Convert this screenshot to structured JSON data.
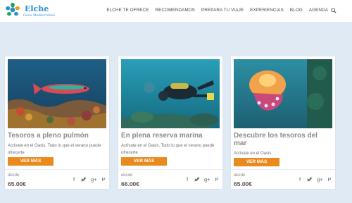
{
  "header": {
    "logo_text": "Elche",
    "logo_subtitle": "Oasis Mediterráneo",
    "nav": [
      "ELCHE TE OFRECE",
      "RECOMENDAMOS",
      "PREPARA TU VIAJE",
      "EXPERIENCIAS",
      "BLOG",
      "AGENDA"
    ]
  },
  "cards": [
    {
      "title": "Tesoros a pleno pulmón",
      "desc": "Actívate en el Oasis, Todo lo que el verano puede ofrecerte",
      "button": "VER MÁS",
      "desde": "desde",
      "price": "65.00€"
    },
    {
      "title": "En plena reserva marina",
      "desc": "Actívate en el Oasis, Todo lo que el verano puede ofrecerte",
      "button": "VER MÁS",
      "desde": "desde",
      "price": "66.00€"
    },
    {
      "title": "Descubre los tesoros del mar",
      "desc": "Actívate en el Oasis",
      "button": "VER MÁS",
      "desde": "desde",
      "price": "65.00€"
    }
  ],
  "share_icons": [
    "facebook-icon",
    "twitter-icon",
    "google-plus-icon",
    "pinterest-icon"
  ],
  "colors": {
    "accent": "#ea8a1e",
    "background": "#dfeaf4",
    "brand": "#2a8fd0"
  }
}
